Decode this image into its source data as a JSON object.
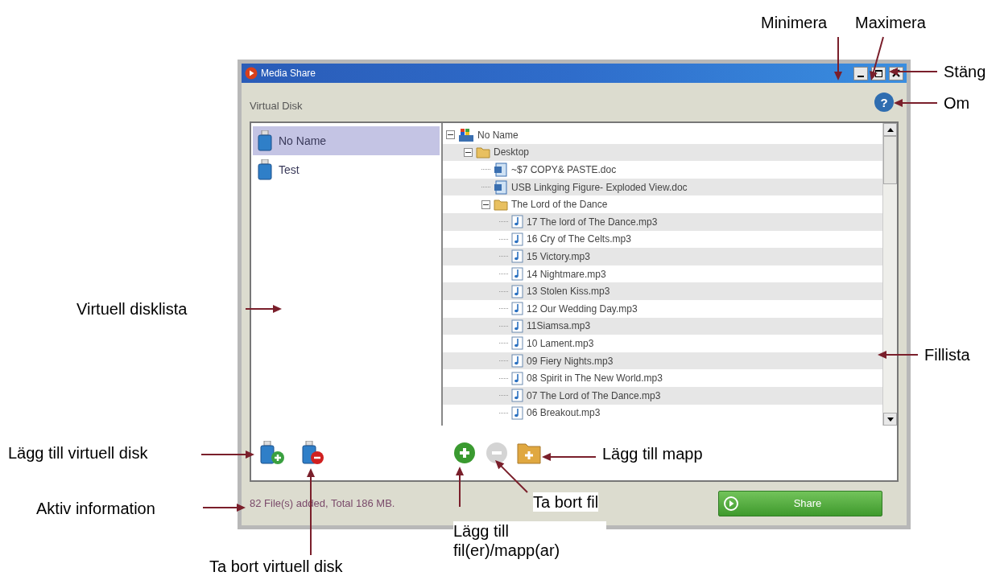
{
  "window": {
    "title": "Media Share"
  },
  "section_title": "Virtual Disk",
  "help_button": "?",
  "disks": [
    {
      "name": "No Name",
      "selected": true
    },
    {
      "name": "Test",
      "selected": false
    }
  ],
  "file_tree": [
    {
      "name": "No Name",
      "kind": "drive",
      "expanded": true,
      "children": [
        {
          "name": "Desktop",
          "kind": "folder",
          "expanded": true,
          "children": [
            {
              "name": "~$7 COPY& PASTE.doc",
              "kind": "document"
            },
            {
              "name": "USB Linkging Figure- Exploded View.doc",
              "kind": "document"
            },
            {
              "name": "The Lord of the Dance",
              "kind": "folder",
              "expanded": true,
              "children": [
                {
                  "name": "17 The lord of The Dance.mp3",
                  "kind": "audio"
                },
                {
                  "name": "16 Cry of The Celts.mp3",
                  "kind": "audio"
                },
                {
                  "name": "15 Victory.mp3",
                  "kind": "audio"
                },
                {
                  "name": "14 Nightmare.mp3",
                  "kind": "audio"
                },
                {
                  "name": "13 Stolen Kiss.mp3",
                  "kind": "audio"
                },
                {
                  "name": "12 Our Wedding Day.mp3",
                  "kind": "audio"
                },
                {
                  "name": "11Siamsa.mp3",
                  "kind": "audio"
                },
                {
                  "name": "10 Lament.mp3",
                  "kind": "audio"
                },
                {
                  "name": "09 Fiery Nights.mp3",
                  "kind": "audio"
                },
                {
                  "name": "08 Spirit in The New World.mp3",
                  "kind": "audio"
                },
                {
                  "name": "07 The Lord of The Dance.mp3",
                  "kind": "audio"
                },
                {
                  "name": "06 Breakout.mp3",
                  "kind": "audio"
                }
              ]
            }
          ]
        }
      ]
    }
  ],
  "disk_actions": [
    {
      "kind": "add-disk",
      "disabled": false
    },
    {
      "kind": "remove-disk",
      "disabled": false
    }
  ],
  "file_actions": [
    {
      "kind": "add",
      "disabled": false
    },
    {
      "kind": "remove",
      "disabled": true
    },
    {
      "kind": "add-folder",
      "disabled": false
    }
  ],
  "status": "82 File(s) added, Total 186 MB.",
  "share_button": "Share",
  "callouts": [
    {
      "text": "Minimera"
    },
    {
      "text": "Maximera"
    },
    {
      "text": "Stäng"
    },
    {
      "text": "Om"
    },
    {
      "text": "Virtuell disklista"
    },
    {
      "text": "Fillista"
    },
    {
      "text": "Lägg till virtuell disk"
    },
    {
      "text": "Lägg till mapp"
    },
    {
      "text": "Ta bort fil"
    },
    {
      "text": "Aktiv information"
    },
    {
      "text": "Lägg till fil(er)/mapp(ar)"
    },
    {
      "text": "Ta bort virtuell disk"
    }
  ]
}
